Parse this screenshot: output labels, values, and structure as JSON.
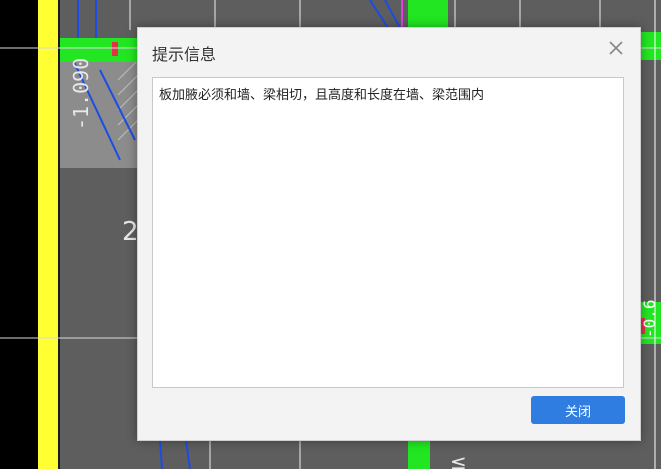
{
  "canvas": {
    "dimension_left": "-1.090",
    "label_mid_left": "2",
    "dimension_right": "-0.6",
    "label_bottom": "≤"
  },
  "dialog": {
    "title": "提示信息",
    "message": "板加腋必须和墙、梁相切，且高度和长度在墙、梁范围内",
    "close_button_label": "关闭",
    "close_icon": "close-x-icon"
  },
  "colors": {
    "cad_background": "#5e5e5e",
    "highlight_yellow": "#ffff33",
    "highlight_green": "#22e622",
    "primary_button": "#2f7de1"
  }
}
